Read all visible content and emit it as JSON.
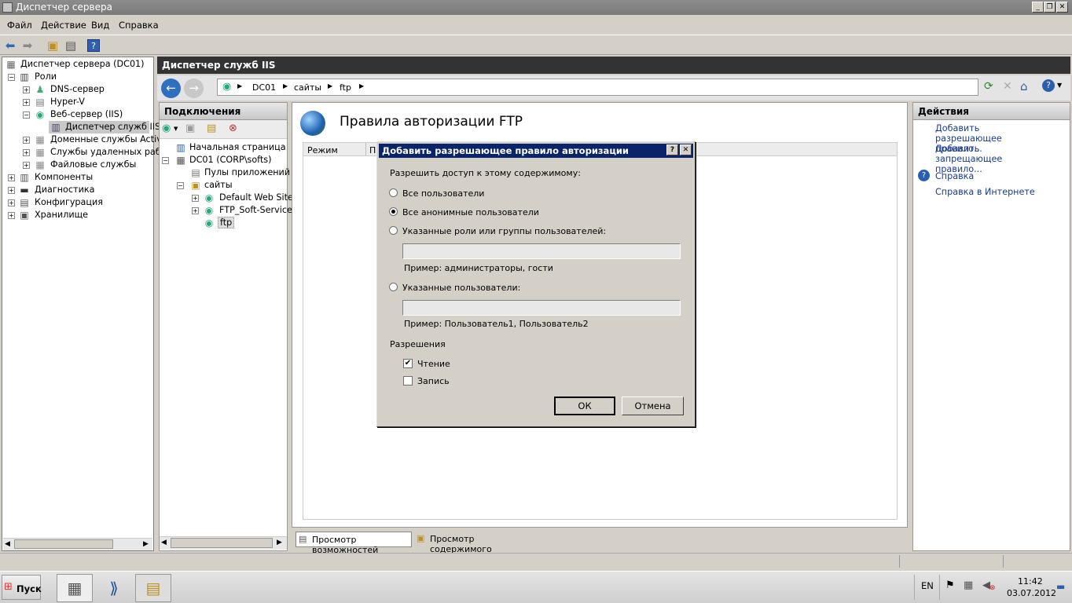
{
  "window": {
    "title": "Диспетчер сервера",
    "min": "_",
    "max": "❐",
    "close": "✕"
  },
  "menu": [
    "Файл",
    "Действие",
    "Вид",
    "Справка"
  ],
  "left_tree": {
    "root": "Диспетчер сервера (DC01)",
    "roles": "Роли",
    "dns": "DNS-сервер",
    "hyperv": "Hyper-V",
    "webserver": "Веб-сервер (IIS)",
    "iis_manager": "Диспетчер служб IIS",
    "ad": "Доменные службы Active",
    "rds": "Службы удаленных рабо",
    "file": "Файловые службы",
    "components": "Компоненты",
    "diagnostics": "Диагностика",
    "configuration": "Конфигурация",
    "storage": "Хранилище"
  },
  "iis": {
    "header": "Диспетчер служб IIS",
    "breadcrumb": [
      "DC01",
      "сайты",
      "ftp"
    ],
    "connections_title": "Подключения",
    "conn_tree": {
      "start": "Начальная страница",
      "server": "DC01 (CORP\\softs)",
      "pools": "Пулы приложений",
      "sites": "сайты",
      "site1": "Default Web Site",
      "site2": "FTP_Soft-Service",
      "site3": "ftp"
    },
    "page_title": "Правила авторизации FTP",
    "col_mode": "Режим",
    "col_p": "П",
    "tab_features": "Просмотр возможностей",
    "tab_content": "Просмотр содержимого"
  },
  "actions": {
    "title": "Действия",
    "add_allow": "Добавить разрешающее правило...",
    "add_deny": "Добавить запрещающее правило...",
    "help": "Справка",
    "help_online": "Справка в Интернете"
  },
  "dialog": {
    "title": "Добавить разрешающее правило авторизации",
    "help_btn": "?",
    "close_btn": "✕",
    "prompt": "Разрешить доступ к этому содержимому:",
    "opt_all": "Все пользователи",
    "opt_anon": "Все анонимные пользователи",
    "opt_roles": "Указанные роли или группы пользователей:",
    "roles_example": "Пример: администраторы, гости",
    "opt_users": "Указанные пользователи:",
    "users_example": "Пример: Пользователь1, Пользователь2",
    "perms_label": "Разрешения",
    "perm_read": "Чтение",
    "perm_write": "Запись",
    "ok": "ОК",
    "cancel": "Отмена",
    "selected_option": "anon",
    "read_checked": true,
    "write_checked": false
  },
  "taskbar": {
    "start": "Пуск",
    "lang": "EN",
    "time": "11:42",
    "date": "03.07.2012"
  }
}
